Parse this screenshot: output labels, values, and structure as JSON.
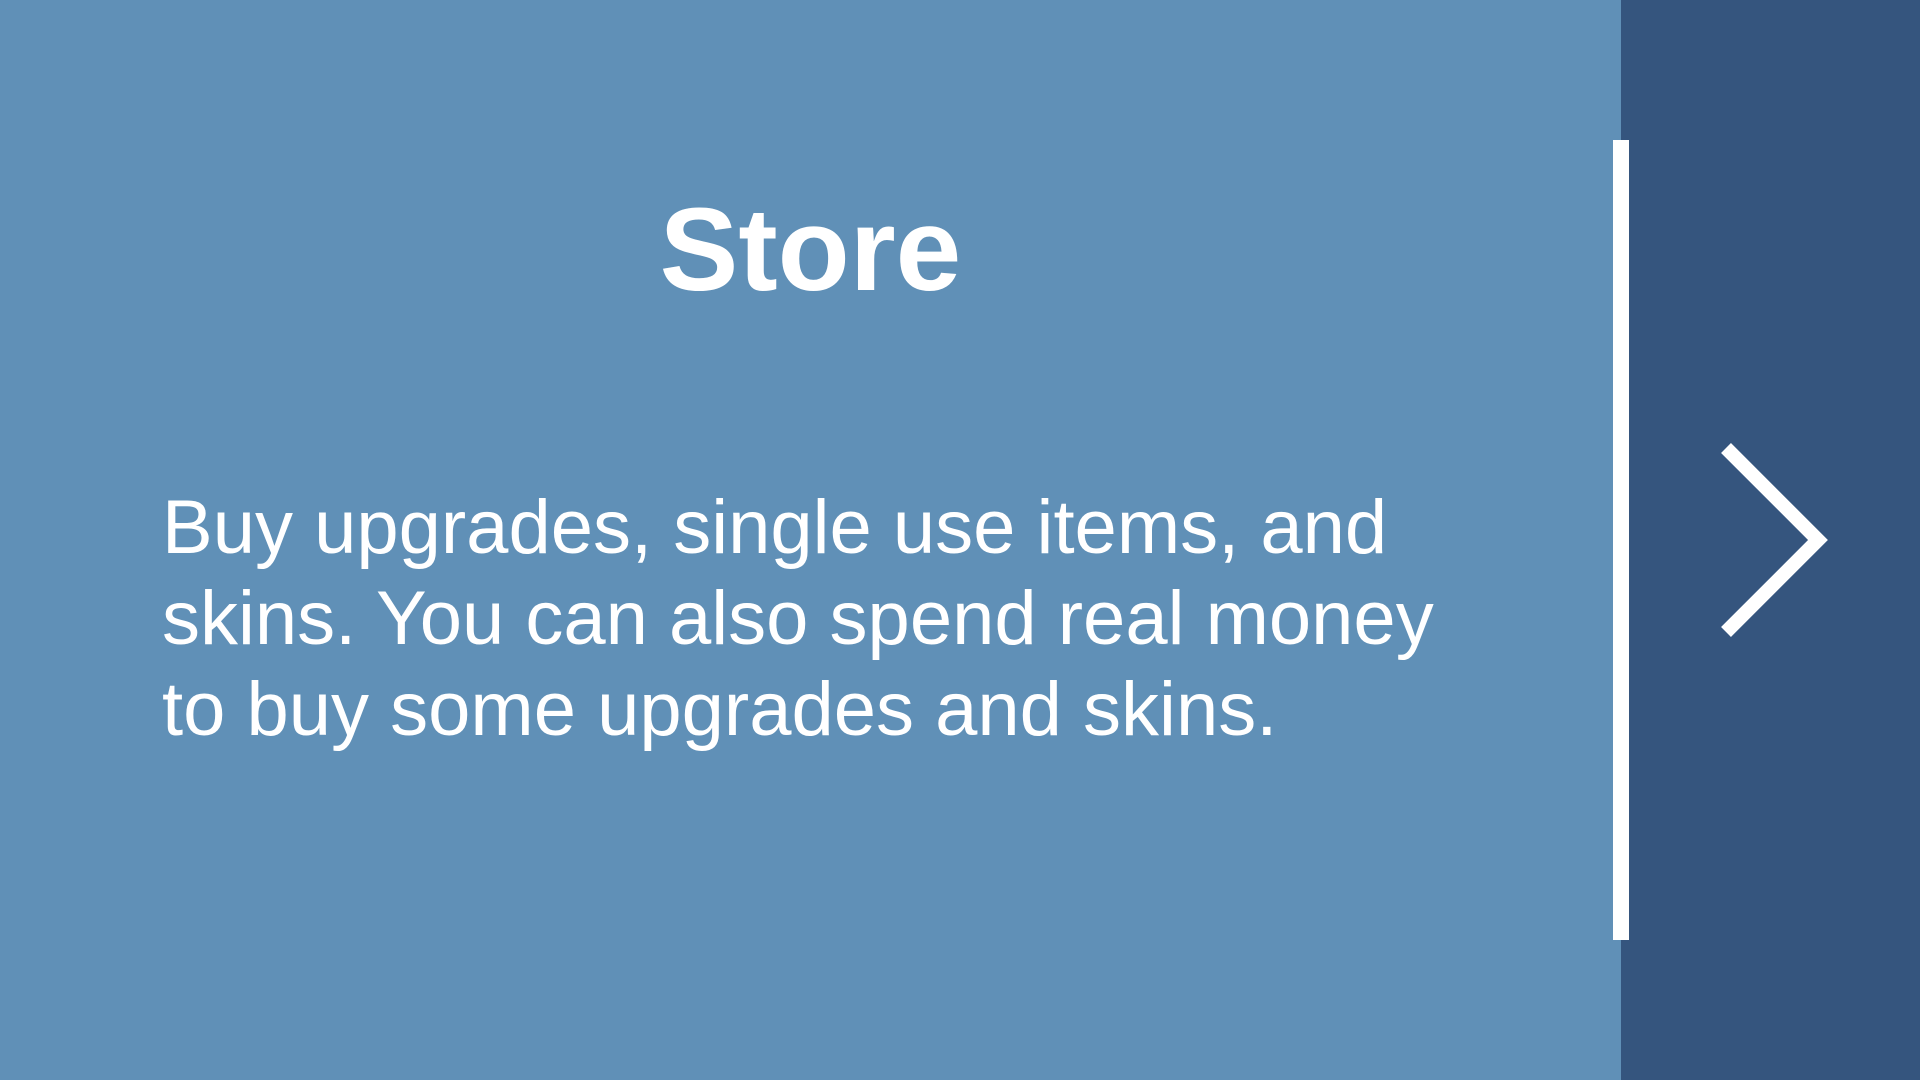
{
  "slide": {
    "title": "Store",
    "description": "Buy upgrades, single use items, and skins. You can also spend real money to buy some upgrades and skins."
  },
  "navigation": {
    "next_icon": "chevron-right-icon"
  },
  "colors": {
    "main_background": "#6090b7",
    "side_background": "#35557e",
    "divider": "#ffffff",
    "text": "#ffffff"
  }
}
